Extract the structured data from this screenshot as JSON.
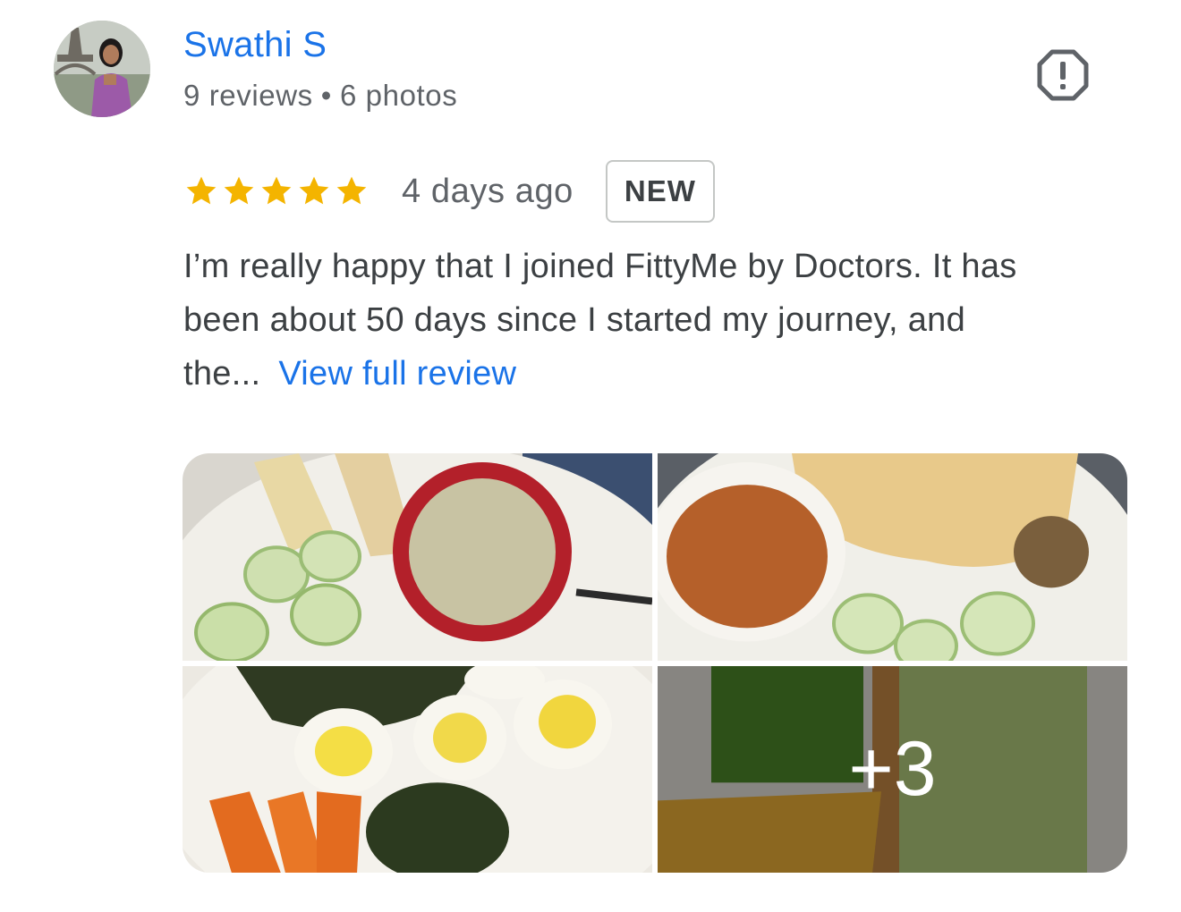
{
  "reviewer": {
    "name": "Swathi S",
    "reviews": "9 reviews",
    "separator": "•",
    "photos": "6 photos"
  },
  "review": {
    "rating": 5,
    "max_rating": 5,
    "date": "4 days ago",
    "badge": "NEW",
    "text_lines": [
      "I’m really happy that I joined FittyMe by Doctors. It has",
      "been about 50 days since I started my journey, and",
      "the..."
    ],
    "view_full": "View full review"
  },
  "photos": {
    "more_count": "+3"
  },
  "icons": {
    "report": "report-flag-icon",
    "star": "star-icon"
  },
  "colors": {
    "link": "#1a73e8",
    "star": "#f4b400",
    "text": "#3c4043",
    "secondary": "#5f6368"
  }
}
